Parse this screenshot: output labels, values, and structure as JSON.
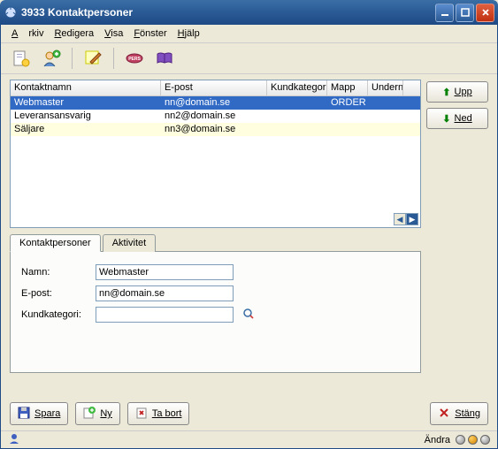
{
  "window": {
    "title": "3933 Kontaktpersoner"
  },
  "menu": {
    "arkiv": "Arkiv",
    "redigera": "Redigera",
    "visa": "Visa",
    "fonster": "Fönster",
    "hjalp": "Hjälp"
  },
  "list": {
    "headers": {
      "name": "Kontaktnamn",
      "email": "E-post",
      "cat": "Kundkategori",
      "folder": "Mapp",
      "under": "Undern"
    },
    "rows": [
      {
        "name": "Webmaster",
        "email": "nn@domain.se",
        "cat": "",
        "folder": "ORDER",
        "under": ""
      },
      {
        "name": "Leveransansvarig",
        "email": "nn2@domain.se",
        "cat": "",
        "folder": "",
        "under": ""
      },
      {
        "name": "Säljare",
        "email": "nn3@domain.se",
        "cat": "",
        "folder": "",
        "under": ""
      }
    ]
  },
  "sidebtns": {
    "up": "Upp",
    "down": "Ned"
  },
  "tabs": {
    "kontakt": "Kontaktpersoner",
    "aktivitet": "Aktivitet"
  },
  "form": {
    "labels": {
      "name": "Namn:",
      "email": "E-post:",
      "cat": "Kundkategori:"
    },
    "values": {
      "name": "Webmaster",
      "email": "nn@domain.se",
      "cat": ""
    }
  },
  "buttons": {
    "spara": "Spara",
    "ny": "Ny",
    "tabort": "Ta bort",
    "stang": "Stäng"
  },
  "status": {
    "andra": "Ändra"
  }
}
